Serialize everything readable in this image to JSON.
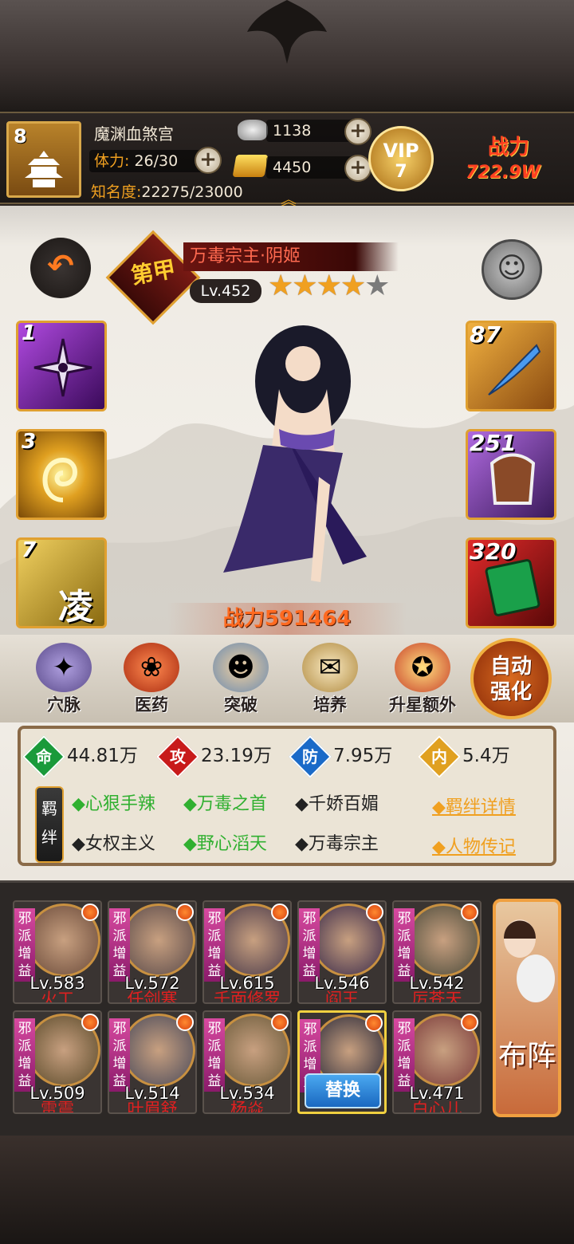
{
  "header": {
    "player_level": "8",
    "player_name": "魔渊血煞宫",
    "stamina_label": "体力:",
    "stamina_value": "26/30",
    "fame_label": "知名度:",
    "fame_value": "22275/23000",
    "silver": "1138",
    "gold": "4450",
    "vip_label": "VIP",
    "vip_level": "7",
    "power_label": "战力",
    "power_value": "722.9W"
  },
  "hero": {
    "grade": "第甲",
    "name": "万毒宗主·阴姬",
    "level": "Lv.452",
    "stars_filled": 4,
    "stars_total": 5,
    "battle_power_label": "战力",
    "battle_power": "591464"
  },
  "skills": [
    {
      "num": "1",
      "color": "#7a2ab0"
    },
    {
      "num": "3",
      "color": "#e0a020"
    },
    {
      "num": "7",
      "color": "#c89020",
      "glyph": "凌"
    }
  ],
  "equipment": [
    {
      "num": "87",
      "color": "#d88a20"
    },
    {
      "num": "251",
      "color": "#8a3ab0"
    },
    {
      "num": "320",
      "color": "#b01a1a"
    }
  ],
  "menu": [
    {
      "label": "穴脉"
    },
    {
      "label": "医药"
    },
    {
      "label": "突破"
    },
    {
      "label": "培养"
    },
    {
      "label": "升星额外"
    }
  ],
  "auto_button": {
    "line1": "自动",
    "line2": "强化"
  },
  "stats": [
    {
      "glyph": "命",
      "value": "44.81万",
      "color": "#1a9a3a"
    },
    {
      "glyph": "攻",
      "value": "23.19万",
      "color": "#c81a1a"
    },
    {
      "glyph": "防",
      "value": "7.95万",
      "color": "#1a6ac8"
    },
    {
      "glyph": "内",
      "value": "5.4万",
      "color": "#e0a020"
    }
  ],
  "bond_tag": "羁绊",
  "bonds": [
    {
      "text": "◆心狠手辣",
      "active": true
    },
    {
      "text": "◆万毒之首",
      "active": true
    },
    {
      "text": "◆千娇百媚",
      "active": false
    },
    {
      "text": "◆女权主义",
      "active": false
    },
    {
      "text": "◆野心滔天",
      "active": true
    },
    {
      "text": "◆万毒宗主",
      "active": false
    }
  ],
  "links": {
    "bond_detail": "◆羁绊详情",
    "biography": "◆人物传记"
  },
  "roster_tag": "邪派增益",
  "roster": [
    {
      "level": "Lv.583",
      "name": "火工"
    },
    {
      "level": "Lv.572",
      "name": "任剑寒"
    },
    {
      "level": "Lv.615",
      "name": "千面修罗"
    },
    {
      "level": "Lv.546",
      "name": "阎王"
    },
    {
      "level": "Lv.542",
      "name": "厉苍天"
    },
    {
      "level": "Lv.509",
      "name": "雷震"
    },
    {
      "level": "Lv.514",
      "name": "叶眉舒"
    },
    {
      "level": "Lv.534",
      "name": "杨焱"
    },
    {
      "level": "",
      "name": "",
      "swap": "替换"
    },
    {
      "level": "Lv.471",
      "name": "白心儿"
    }
  ],
  "formation_label": "布阵"
}
